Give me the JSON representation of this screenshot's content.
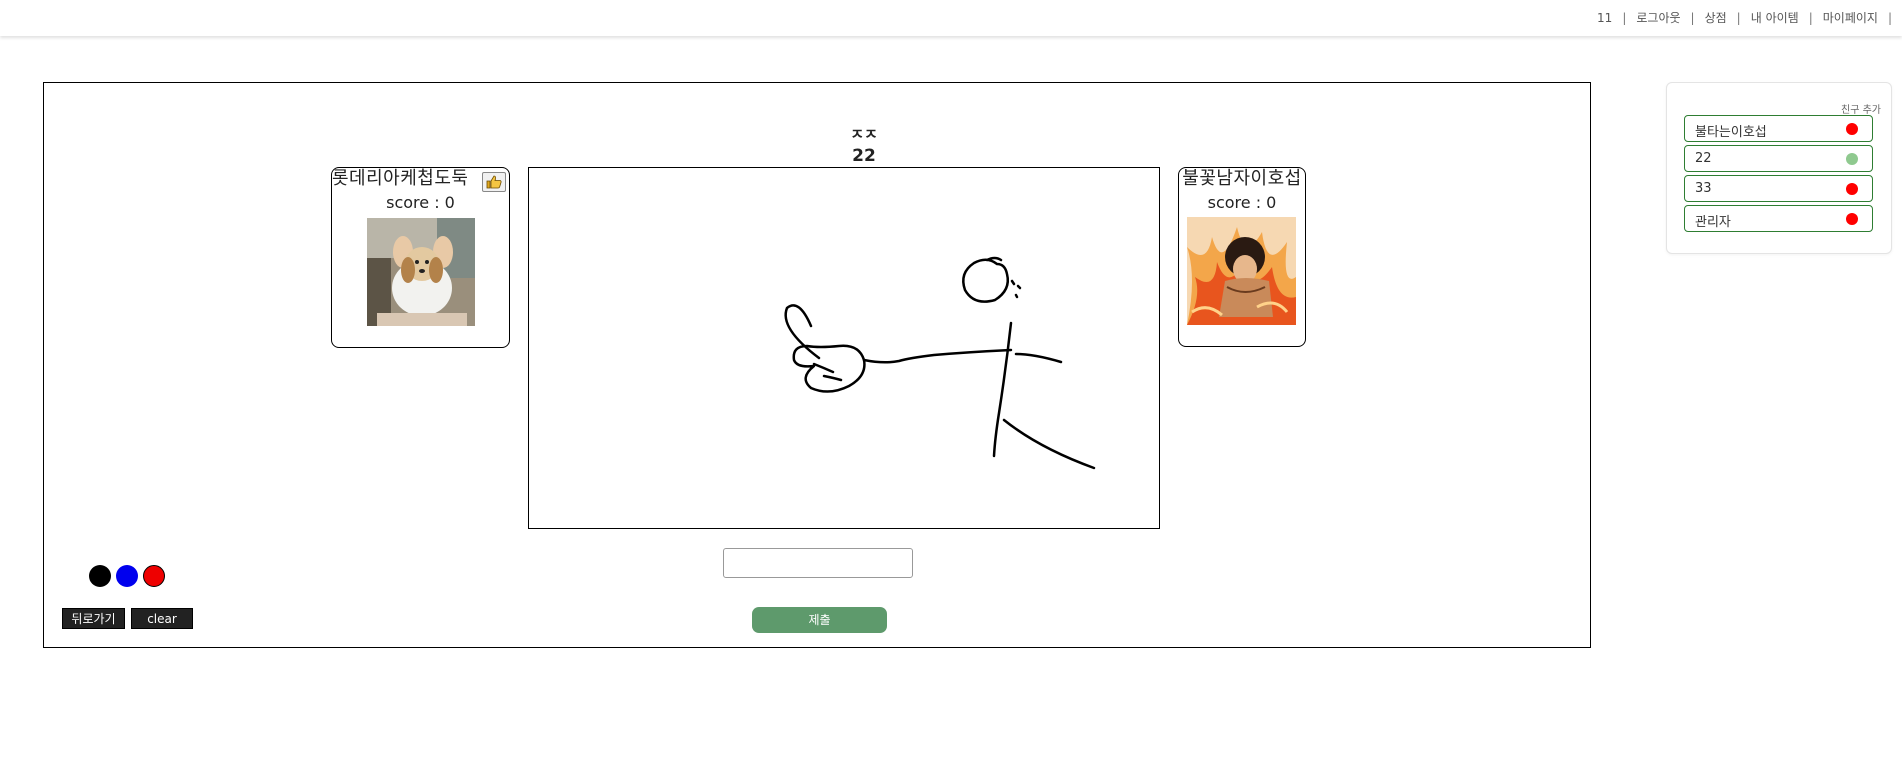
{
  "nav": {
    "user": "11",
    "logout": "로그아웃",
    "shop": "상점",
    "my_items": "내 아이템",
    "my_page": "마이페이지",
    "separator": "|"
  },
  "game": {
    "word": "ㅈㅈ",
    "timer": "22",
    "players": [
      {
        "name": "롯데리아케첩도둑",
        "score": "score : 0",
        "avatar": "dog-photo"
      },
      {
        "name": "불꽃남자이호섭",
        "score": "score : 0",
        "avatar": "fire-character-art"
      }
    ],
    "answer_input": {
      "value": "",
      "placeholder": ""
    },
    "submit_label": "제출",
    "back_label": "뒤로가기",
    "clear_label": "clear",
    "palette": [
      "#000000",
      "#0000ee",
      "#ee0000"
    ]
  },
  "friends": {
    "add_label": "친구 추가",
    "list": [
      {
        "name": "불타는이호섭",
        "status_color": "#ff0000"
      },
      {
        "name": "22",
        "status_color": "#8fc98f"
      },
      {
        "name": "33",
        "status_color": "#ff0000"
      },
      {
        "name": "관리자",
        "status_color": "#ff0000"
      }
    ]
  }
}
